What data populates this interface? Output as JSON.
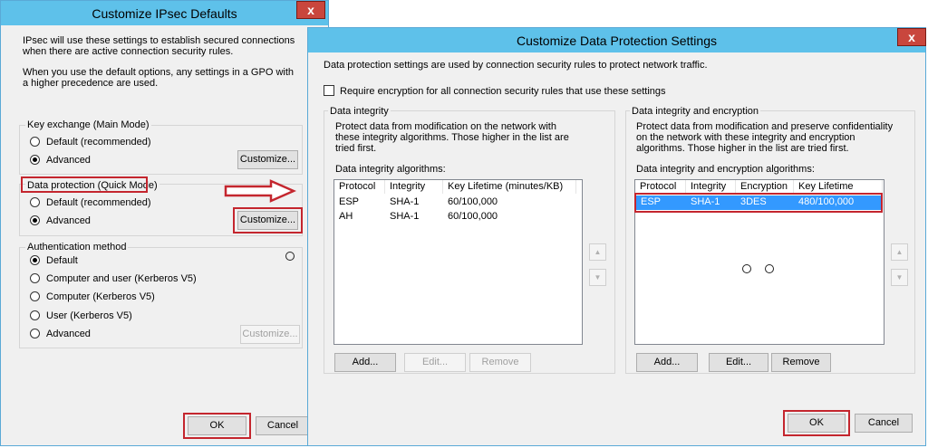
{
  "left_dialog": {
    "title": "Customize IPsec Defaults",
    "close_label": "x",
    "intro": "IPsec will use these settings to establish secured connections when there are active connection security rules.",
    "note": "When you use the default options, any settings in a GPO with a higher precedence are used.",
    "key_exchange": {
      "title": "Key exchange (Main Mode)",
      "options": [
        "Default (recommended)",
        "Advanced"
      ],
      "selected": "Advanced",
      "customize_label": "Customize..."
    },
    "data_protection": {
      "title": "Data protection (Quick Mode)",
      "options": [
        "Default (recommended)",
        "Advanced"
      ],
      "selected": "Advanced",
      "customize_label": "Customize..."
    },
    "authentication": {
      "title": "Authentication method",
      "options": [
        "Default",
        "Computer and user (Kerberos V5)",
        "Computer (Kerberos V5)",
        "User (Kerberos V5)",
        "Advanced"
      ],
      "selected": "Default",
      "customize_label": "Customize..."
    },
    "ok_label": "OK",
    "cancel_label": "Cancel"
  },
  "right_dialog": {
    "title": "Customize Data Protection Settings",
    "close_label": "x",
    "intro": "Data protection settings are used by connection security rules to protect network traffic.",
    "require_encryption_label": "Require encryption for all connection security rules that use these settings",
    "require_encryption_checked": false,
    "integrity": {
      "title": "Data integrity",
      "description": "Protect data from modification on the network with these integrity algorithms. Those higher in the list are tried first.",
      "list_label": "Data integrity algorithms:",
      "columns": [
        "Protocol",
        "Integrity",
        "Key Lifetime (minutes/KB)"
      ],
      "rows": [
        [
          "ESP",
          "SHA-1",
          "60/100,000"
        ],
        [
          "AH",
          "SHA-1",
          "60/100,000"
        ]
      ],
      "add_label": "Add...",
      "edit_label": "Edit...",
      "remove_label": "Remove"
    },
    "encryption": {
      "title": "Data integrity and encryption",
      "description": "Protect data from modification and preserve confidentiality on the network with these integrity and encryption algorithms. Those higher in the list are tried first.",
      "list_label": "Data integrity and encryption algorithms:",
      "columns": [
        "Protocol",
        "Integrity",
        "Encryption",
        "Key Lifetime (min..."
      ],
      "rows": [
        [
          "ESP",
          "SHA-1",
          "3DES",
          "480/100,000"
        ]
      ],
      "add_label": "Add...",
      "edit_label": "Edit...",
      "remove_label": "Remove"
    },
    "ok_label": "OK",
    "cancel_label": "Cancel"
  },
  "colors": {
    "titlebar": "#5ec1ea",
    "highlight_red": "#c4262e",
    "selection": "#3399ff"
  }
}
